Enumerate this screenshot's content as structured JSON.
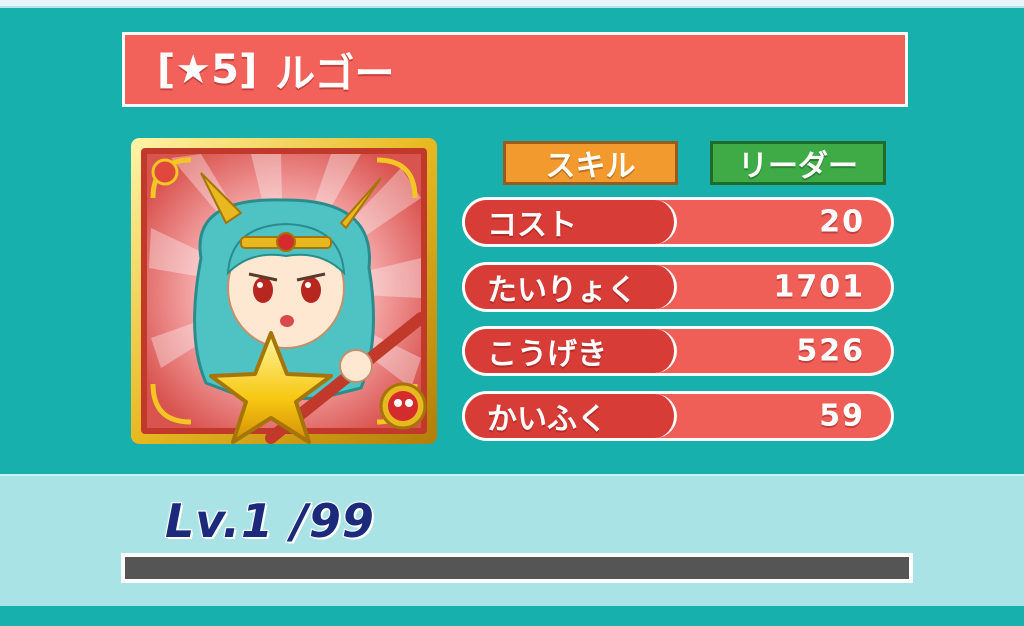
{
  "card": {
    "rarity_label": "[★5]",
    "name": "ルゴー"
  },
  "tabs": {
    "skill_label": "スキル",
    "leader_label": "リーダー"
  },
  "stats": [
    {
      "label": "コスト",
      "value": "20"
    },
    {
      "label": "たいりょく",
      "value": "1701"
    },
    {
      "label": "こうげき",
      "value": "526"
    },
    {
      "label": "かいふく",
      "value": "59"
    }
  ],
  "level": {
    "text": "Lv.1 /99",
    "exp_fraction": 0
  },
  "colors": {
    "background": "#17b0ac",
    "title_banner": "#f2625a",
    "skill_tab": "#f29a2e",
    "leader_tab": "#3eab47",
    "stat_pill": "#d83c36",
    "stat_row": "#ef5f57",
    "level_band": "#a9e3e6",
    "level_text": "#1b2a7a"
  },
  "portrait": {
    "icon": "character-portrait-icon"
  }
}
